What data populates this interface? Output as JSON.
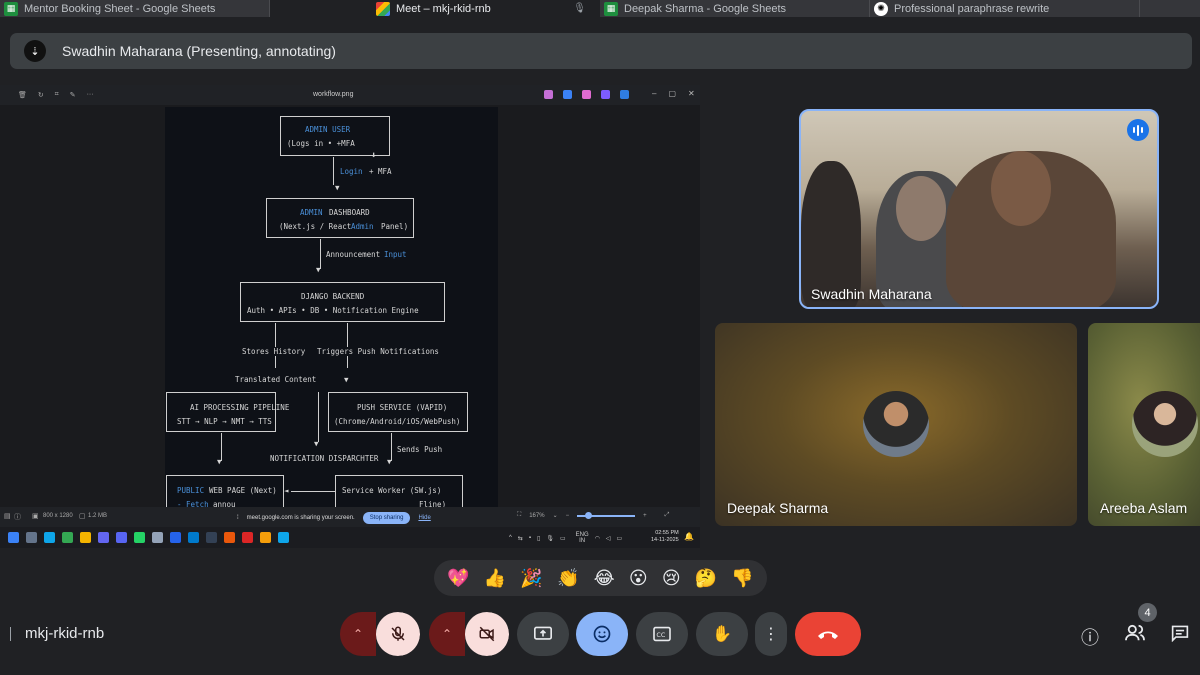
{
  "tabs": [
    {
      "title": "Mentor Booking Sheet - Google Sheets",
      "icon": "sheets-icon"
    },
    {
      "title": "Meet – mkj-rkid-rnb",
      "icon": "meet-icon",
      "active": true
    },
    {
      "title": "Deepak Sharma - Google Sheets",
      "icon": "sheets-icon"
    },
    {
      "title": "Professional paraphrase rewrite",
      "icon": "chatgpt-icon"
    }
  ],
  "banner": {
    "text": "Swadhin Maharana (Presenting, annotating)"
  },
  "viewer": {
    "filename": "workflow.png",
    "dimensions": "800 x 1280",
    "filesize": "1.2 MB",
    "zoom": "167%",
    "sharing_text": "meet.google.com is sharing your screen.",
    "stop_label": "Stop sharing",
    "hide_label": "Hide"
  },
  "diagram": {
    "admin_user": "ADMIN USER",
    "admin_user_sub": "(Logs in • +MFA",
    "login_label_a": "Login",
    "login_label_b": "+ MFA",
    "dashboard_title_a": "ADMIN",
    "dashboard_title_b": "DASHBOARD",
    "dashboard_sub_a": "(Next.js / React",
    "dashboard_sub_b": "Admin",
    "dashboard_sub_c": "Panel)",
    "announcement_a": "Announcement",
    "announcement_b": "Input",
    "backend_title": "DJANGO BACKEND",
    "backend_sub": "Auth • APIs • DB • Notification Engine",
    "stores_history": "Stores History",
    "triggers_push": "Triggers Push Notifications",
    "translated_content": "Translated Content",
    "ai_title": "AI PROCESSING PIPELINE",
    "ai_sub": "STT → NLP → NMT → TTS",
    "push_title": "PUSH SERVICE (VAPID)",
    "push_sub": "(Chrome/Android/iOS/WebPush)",
    "sends_push": "Sends Push",
    "dispatcher": "NOTIFICATION DISPARCHTER",
    "public_a": "PUBLIC",
    "public_b": "WEB PAGE (Next)",
    "worker": "Service Worker (SW.js)",
    "fetch_a": "- Fetch",
    "fetch_b": "annou",
    "fline": "Fline)"
  },
  "taskbar": {
    "lang": "ENG",
    "region": "IN",
    "time": "02:55 PM",
    "date": "14-11-2025"
  },
  "participants": [
    {
      "name": "Swadhin Maharana",
      "speaking": true
    },
    {
      "name": "Deepak Sharma"
    },
    {
      "name": "Areeba Aslam"
    }
  ],
  "reactions": [
    "💖",
    "👍",
    "🎉",
    "👏",
    "😂",
    "😮",
    "😢",
    "🤔",
    "👎"
  ],
  "meeting": {
    "code": "mkj-rkid-rnb",
    "participant_count": "4"
  },
  "colors": {
    "accent": "#8ab4f8",
    "hangup": "#ea4335",
    "muted_bg": "#f9dedc"
  }
}
